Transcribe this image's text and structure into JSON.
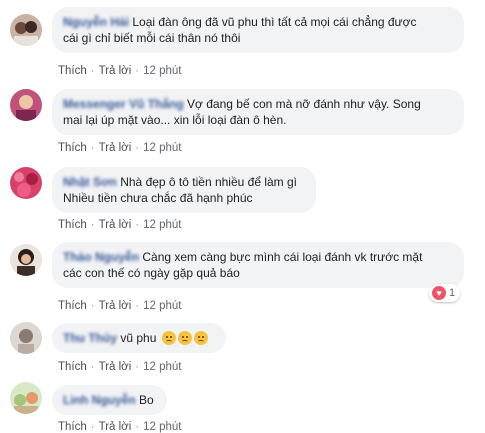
{
  "comments": [
    {
      "author": "Nguyễn Hải",
      "text_lines": [
        "Loại đàn ông đã vũ phu thì tất cả mọi cái chẳng được",
        "cái gì chỉ biết mỗi cái thân nó thôi"
      ],
      "like_label": "Thích",
      "reply_label": "Trả lời",
      "time": "12 phút"
    },
    {
      "author": "Messenger Vũ Thắng",
      "text_lines": [
        "Vợ đang bế con mà nỡ đánh như vậy. Song",
        "mai lại úp mặt vào... xin lỗi loại đàn ô hèn."
      ],
      "like_label": "Thích",
      "reply_label": "Trả lời",
      "time": "12 phút"
    },
    {
      "author": "Nhật Sơn",
      "text_lines": [
        "Nhà đẹp ô tô tiền nhiều để làm gì",
        "Nhiều tiền chưa chắc đã hạnh phúc"
      ],
      "like_label": "Thích",
      "reply_label": "Trả lời",
      "time": "12 phút"
    },
    {
      "author": "Thảo Nguyễn",
      "text_lines": [
        "Càng xem càng bực mình cái loại đánh vk trước mặt",
        "các con thế có ngày gặp quả báo"
      ],
      "like_label": "Thích",
      "reply_label": "Trả lời",
      "time": "12 phút",
      "reaction_count": "1"
    },
    {
      "author": "Thu Thủy",
      "text_lines": [
        "vũ phu"
      ],
      "emoji_count": 3,
      "like_label": "Thích",
      "reply_label": "Trả lời",
      "time": "12 phút"
    },
    {
      "author": "Linh Nguyễn",
      "text_lines": [
        "Bo"
      ],
      "like_label": "Thích",
      "reply_label": "Trả lời",
      "time": "12 phút"
    }
  ],
  "colors": {
    "bubble": "#f2f3f5",
    "name": "#385898",
    "reaction": "#f25268"
  },
  "icons": {
    "reaction": "heart-icon",
    "emoji": "angry-face-icon"
  }
}
